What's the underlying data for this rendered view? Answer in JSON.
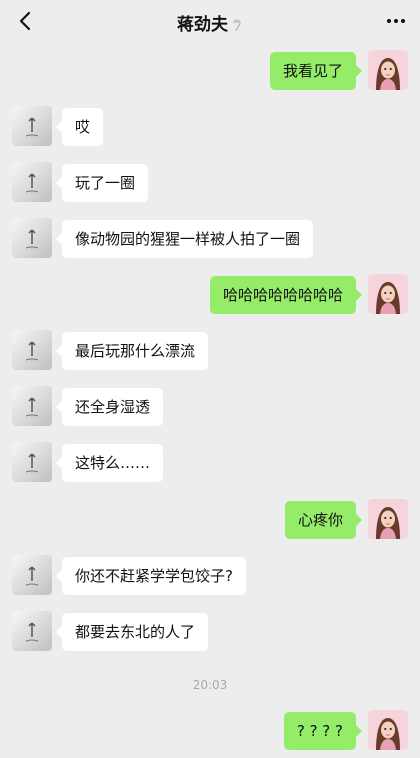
{
  "header": {
    "title": "蒋劲夫",
    "back_icon": "chevron-left-icon",
    "status_icon": "ear-icon",
    "more_icon": "more-dots-icon"
  },
  "messages": [
    {
      "side": "right",
      "text": "我看见了"
    },
    {
      "side": "left",
      "text": "哎"
    },
    {
      "side": "left",
      "text": "玩了一圈"
    },
    {
      "side": "left",
      "text": "像动物园的猩猩一样被人拍了一圈"
    },
    {
      "side": "right",
      "text": "哈哈哈哈哈哈哈哈"
    },
    {
      "side": "left",
      "text": "最后玩那什么漂流"
    },
    {
      "side": "left",
      "text": "还全身湿透"
    },
    {
      "side": "left",
      "text": "这特么……"
    },
    {
      "side": "right",
      "text": "心疼你"
    },
    {
      "side": "left",
      "text": "你还不赶紧学学包饺子?"
    },
    {
      "side": "left",
      "text": "都要去东北的人了"
    },
    {
      "side": "right",
      "text": "? ? ? ?"
    }
  ],
  "timestamp": "20:03",
  "colors": {
    "background": "#ededed",
    "sent_bubble": "#95ec69",
    "received_bubble": "#ffffff"
  }
}
